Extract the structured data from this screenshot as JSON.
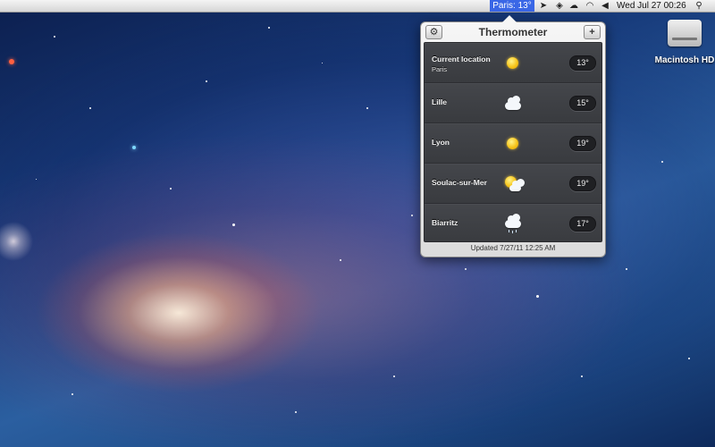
{
  "menubar": {
    "status_item": "Paris: 13°",
    "clock": "Wed Jul 27  00:26",
    "icons": [
      "location-arrow-icon",
      "dropbox-icon",
      "cloud-icon",
      "wifi-icon",
      "volume-icon",
      "spotlight-search-icon"
    ]
  },
  "desktop": {
    "drive_label": "Macintosh HD"
  },
  "popover": {
    "title": "Thermometer",
    "settings_icon": "⚙",
    "add_icon": "+",
    "locations": [
      {
        "name": "Current location",
        "sublabel": "Paris",
        "weather": "sunny",
        "temp": "13°"
      },
      {
        "name": "Lille",
        "weather": "cloudy",
        "temp": "15°"
      },
      {
        "name": "Lyon",
        "weather": "sunny",
        "temp": "19°"
      },
      {
        "name": "Soulac-sur-Mer",
        "weather": "partly-cloudy",
        "temp": "19°"
      },
      {
        "name": "Biarritz",
        "weather": "rain",
        "temp": "17°"
      }
    ],
    "updated": "Updated 7/27/11 12:25 AM"
  },
  "colors": {
    "menu_highlight": "#3a67e6",
    "list_background": "#3b3d42"
  }
}
